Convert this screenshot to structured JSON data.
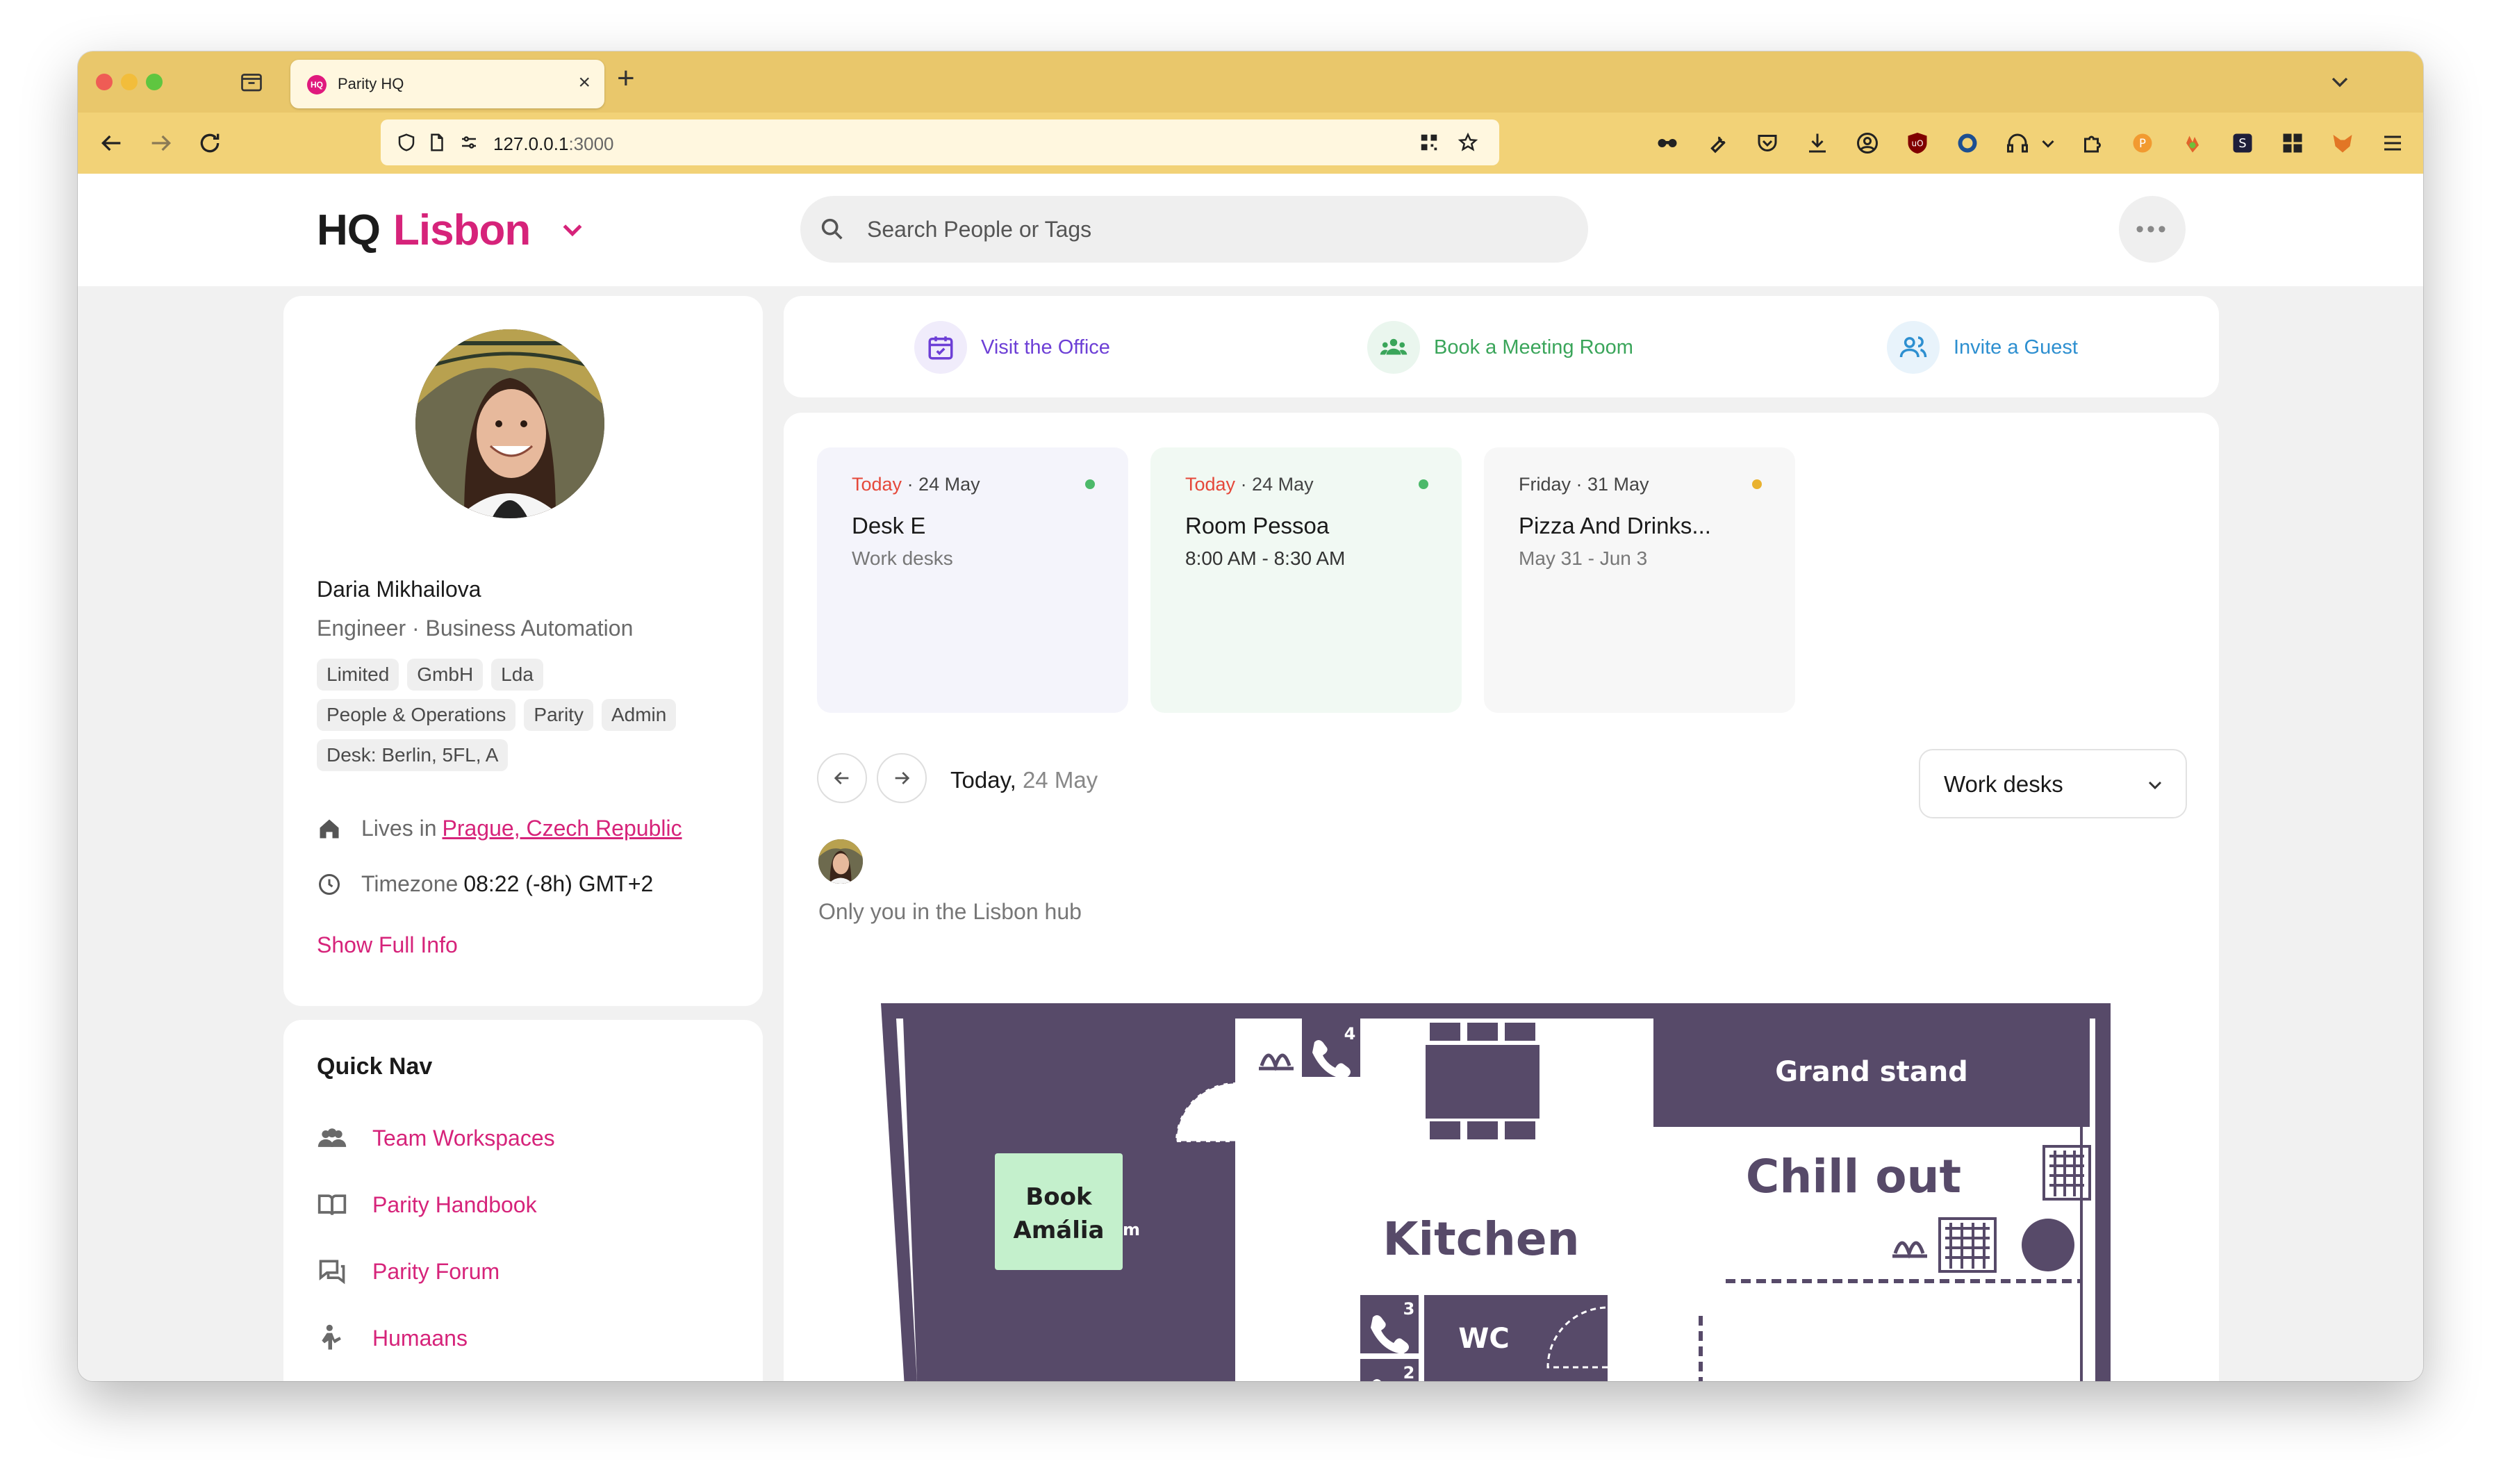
{
  "browser": {
    "tab_title": "Parity HQ",
    "tab_favicon_text": "HQ",
    "url_host": "127.0.0.1",
    "url_port": ":3000"
  },
  "header": {
    "logo_prefix": "HQ",
    "logo_city": "Lisbon",
    "search_placeholder": "Search People or Tags",
    "more_label": "•••"
  },
  "profile": {
    "name": "Daria Mikhailova",
    "role": "Engineer · Business Automation",
    "chips": [
      [
        "Limited",
        "GmbH",
        "Lda"
      ],
      [
        "People & Operations",
        "Parity",
        "Admin"
      ],
      [
        "Desk: Berlin, 5FL, A"
      ]
    ],
    "lives_label": "Lives in",
    "lives_value": "Prague, Czech Republic",
    "timezone_label": "Timezone",
    "timezone_value": "08:22 (-8h) GMT+2",
    "show_full": "Show Full Info"
  },
  "quick_nav": {
    "title": "Quick Nav",
    "items": [
      {
        "label": "Team Workspaces",
        "icon": "team-icon"
      },
      {
        "label": "Parity Handbook",
        "icon": "book-icon"
      },
      {
        "label": "Parity Forum",
        "icon": "forum-icon"
      },
      {
        "label": "Humaans",
        "icon": "person-icon"
      }
    ]
  },
  "actions": [
    {
      "label": "Visit the Office",
      "icon": "calendar-check-icon",
      "color": "#6d3fd6",
      "bg": "#f0ecfb"
    },
    {
      "label": "Book a Meeting Room",
      "icon": "group-icon",
      "color": "#3aa55a",
      "bg": "#eaf6ee"
    },
    {
      "label": "Invite a Guest",
      "icon": "guest-icon",
      "color": "#2d8fd0",
      "bg": "#e8f3fb"
    }
  ],
  "bookings": [
    {
      "day": "Today",
      "date": " · 24 May",
      "title": "Desk E",
      "subtitle": "Work desks",
      "dot_color": "#4cb96a",
      "bg": "#f4f4fb",
      "day_is_today": true
    },
    {
      "day": "Today",
      "date": " · 24 May",
      "title": "Room Pessoa",
      "subtitle": "8:00 AM - 8:30 AM",
      "dot_color": "#4cb96a",
      "bg": "#f1f9f3",
      "day_is_today": true
    },
    {
      "day": "Friday",
      "date": " · 31 May",
      "title": "Pizza And Drinks...",
      "subtitle": "May 31 - Jun 3",
      "dot_color": "#e9b230",
      "bg": "#f7f7f7",
      "day_is_today": false
    }
  ],
  "date_nav": {
    "today": "Today,",
    "date": " 24 May"
  },
  "filter": {
    "selected": "Work desks"
  },
  "hub_text": "Only you in the Lisbon hub",
  "floorplan": {
    "book_label_1": "Book",
    "book_label_2": "Amália",
    "grand_stand": "Grand stand",
    "chill_out": "Chill out",
    "kitchen": "Kitchen",
    "wc": "WC",
    "phone_numbers": [
      "4",
      "3",
      "2"
    ],
    "room_color": "#574a69",
    "desk_highlight": "#c4f0cc"
  },
  "colors": {
    "accent": "#d6237a",
    "tabbar": "#e9c76b",
    "navbar": "#f2d277"
  }
}
